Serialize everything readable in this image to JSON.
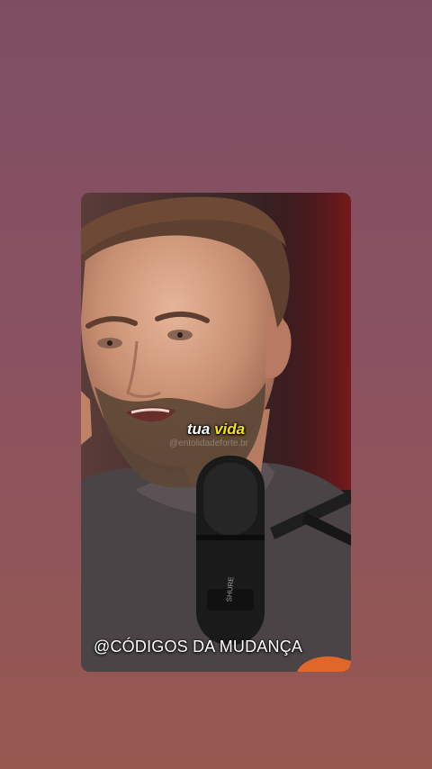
{
  "video": {
    "caption_word_1": "tua",
    "caption_word_2": "vida",
    "watermark": "@entolidadeforte.br",
    "handle": "@CÓDIGOS DA MUDANÇA",
    "mic_brand": "SHURE"
  },
  "colors": {
    "background_top": "#7d4e62",
    "background_bottom": "#96584f",
    "caption_white": "#ffffff",
    "caption_highlight": "#f6e600"
  }
}
